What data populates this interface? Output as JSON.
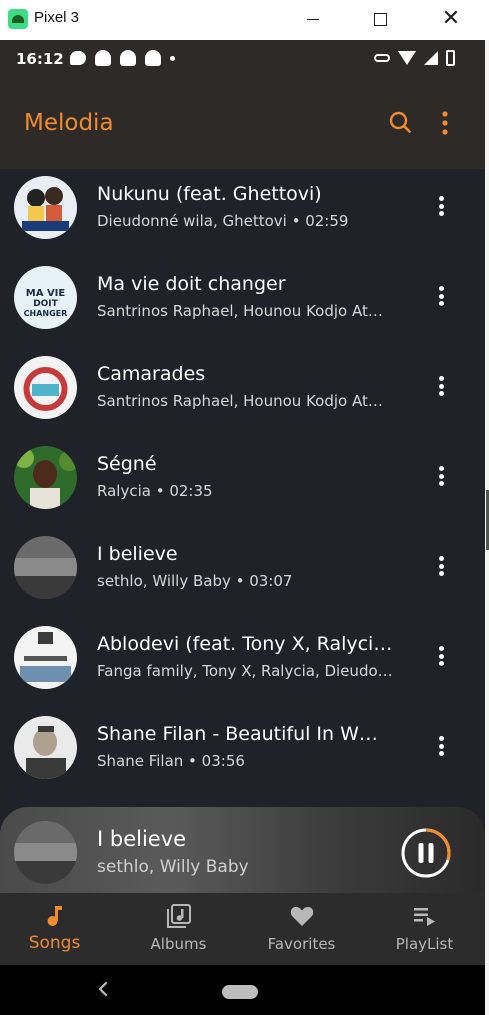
{
  "window": {
    "title": "Pixel 3"
  },
  "status_bar": {
    "time": "16:12"
  },
  "app_bar": {
    "title": "Melodia"
  },
  "songs": [
    {
      "title": "Nukunu (feat. Ghettovi)",
      "subtitle": "Dieudonné wila, Ghettovi • 02:59",
      "cover_colors": [
        "#e9eef4",
        "#f2c94c",
        "#222222"
      ]
    },
    {
      "title": "Ma vie doit changer",
      "subtitle": "Santrinos Raphael, Hounou Kodjo At…",
      "cover_colors": [
        "#e6f2f8",
        "#1a2a4a",
        "#d0e6f2"
      ]
    },
    {
      "title": "Camarades",
      "subtitle": "Santrinos Raphael, Hounou Kodjo At…",
      "cover_colors": [
        "#f3f3f3",
        "#c73a3a",
        "#e8e8e8"
      ]
    },
    {
      "title": "Ségné",
      "subtitle": "Ralycia • 02:35",
      "cover_colors": [
        "#2f6b2a",
        "#4c2a1c",
        "#7cb342"
      ]
    },
    {
      "title": "I believe",
      "subtitle": "sethlo, Willy Baby • 03:07",
      "cover_colors": [
        "#6a6a6a",
        "#3a3a3a",
        "#9a9a9a"
      ]
    },
    {
      "title": "Ablodevi (feat. Tony X, Ralyci…",
      "subtitle": "Fanga family, Tony X, Ralycia, Dieudo…",
      "cover_colors": [
        "#f4f4f4",
        "#3b3b3b",
        "#6d8fb0"
      ]
    },
    {
      "title": "Shane Filan - Beautiful In W…",
      "subtitle": "Shane Filan • 03:56",
      "cover_colors": [
        "#eaeaea",
        "#3a3a3a",
        "#b0a090"
      ]
    }
  ],
  "now_playing": {
    "title": "I believe",
    "artist": "sethlo, Willy Baby",
    "progress": 0.3
  },
  "bottom_nav": [
    {
      "label": "Songs",
      "icon": "music-note-icon",
      "active": true
    },
    {
      "label": "Albums",
      "icon": "album-icon",
      "active": false
    },
    {
      "label": "Favorites",
      "icon": "heart-icon",
      "active": false
    },
    {
      "label": "PlayList",
      "icon": "playlist-icon",
      "active": false
    }
  ],
  "colors": {
    "accent": "#f28b2c",
    "background": "#1f2329",
    "app_bar": "#2e2a28",
    "nav": "#2c2c2c"
  }
}
